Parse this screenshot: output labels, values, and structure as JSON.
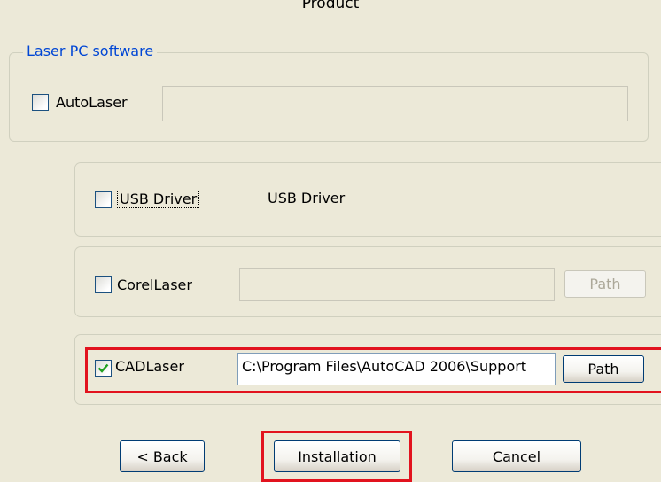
{
  "header": {
    "title": "Product"
  },
  "laser_group": {
    "legend": "Laser PC software",
    "autolaser": {
      "label": "AutoLaser",
      "checked": false,
      "path_value": ""
    }
  },
  "usb_driver": {
    "label": "USB Driver",
    "checked": false,
    "description": "USB Driver"
  },
  "corellaser": {
    "label": "CorelLaser",
    "checked": false,
    "path_value": "",
    "path_button": "Path"
  },
  "cadlaser": {
    "label": "CADLaser",
    "checked": true,
    "path_value": "C:\\Program Files\\AutoCAD 2006\\Support",
    "path_button": "Path"
  },
  "footer": {
    "back_label": "< Back",
    "install_label": "Installation",
    "cancel_label": "Cancel"
  },
  "colors": {
    "highlight": "#E2131E",
    "legend": "#0046D5",
    "check": "#21A121"
  }
}
